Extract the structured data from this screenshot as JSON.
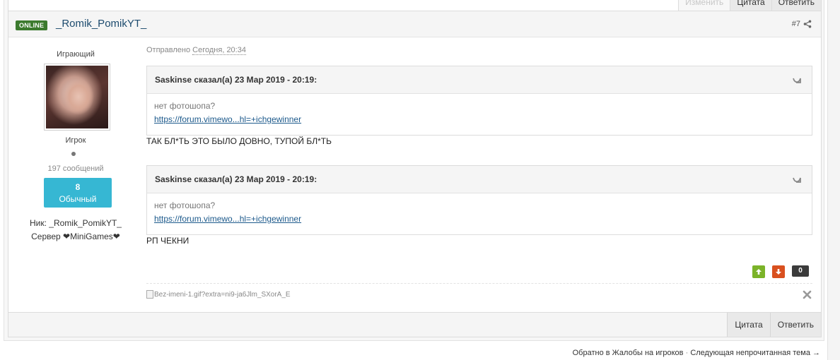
{
  "prev_post": {
    "edit_label": "Изменить",
    "quote_label": "Цитата",
    "reply_label": "Ответить"
  },
  "post": {
    "online_label": "ONLINE",
    "author": "_Romik_PomikYT_",
    "number": "#7",
    "author_info": {
      "title": "Играющий",
      "group": "Игрок",
      "post_count": "197 сообщений",
      "reputation_count": "8",
      "reputation_label": "Обычный",
      "nick_line": "Ник: _Romik_PomikYT_",
      "server_line": "Сервер ❤MiniGames❤"
    },
    "meta_prefix": "Отправлено",
    "date": "Сегодня, 20:34",
    "quotes": [
      {
        "citation": "Saskinse сказал(а) 23 Мар 2019 - 20:19:",
        "text": "нет фотошопа?",
        "link": "https://forum.vimewo...hl=+ichgewinner"
      },
      {
        "citation": "Saskinse сказал(а) 23 Мар 2019 - 20:19:",
        "text": "нет фотошопа?",
        "link": "https://forum.vimewo...hl=+ichgewinner"
      }
    ],
    "lines": [
      "ТАК БЛ*ТЬ ЭТО БЫЛО ДОВНО, ТУПОЙ БЛ*ТЬ",
      "РП ЧЕКНИ"
    ],
    "vote_count": "0",
    "signature_image_alt": "Bez-imeni-1.gif?extra=ni9-ja6Jlm_SXorA_E",
    "controls": {
      "quote_label": "Цитата",
      "reply_label": "Ответить"
    }
  },
  "bottom_nav": {
    "back_link": "Обратно в Жалобы на игроков",
    "separator": "·",
    "next_link": "Следующая непрочитанная тема →"
  },
  "colors": {
    "online_badge": "#3c7a2e",
    "author_link": "#1d4b6e",
    "reputation": "#36b7d3",
    "vote_up": "#7bb329",
    "vote_down": "#d9501f",
    "vote_count": "#3b3b3b",
    "quote_link": "#1d5a8c"
  },
  "icons": [
    "share-icon",
    "quote-arrow-icon",
    "arrow-up-icon",
    "arrow-down-icon",
    "broken-image-icon",
    "close-icon"
  ]
}
